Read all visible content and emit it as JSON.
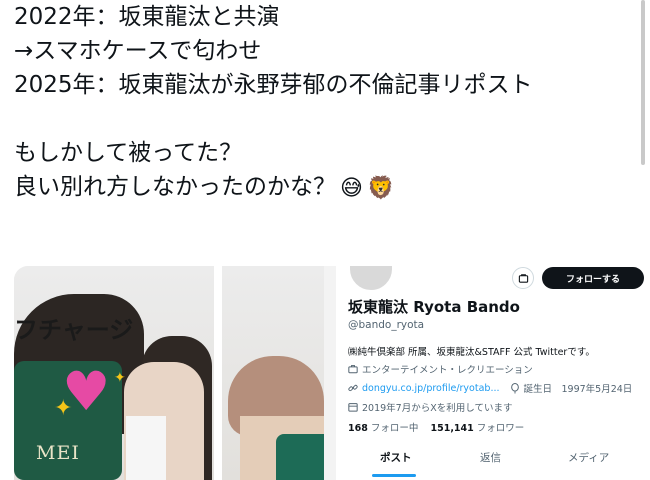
{
  "post": {
    "line1": "2022年：坂東龍汰と共演",
    "line2": "→スマホケースで匂わせ",
    "line3": "2025年：坂東龍汰が永野芽郁の不倫記事リポスト",
    "line4": "もしかして被ってた？",
    "line5": "良い別れ方しなかったのかな？",
    "emoji1": "😅",
    "emoji2": "🦁"
  },
  "photo": {
    "sign_text": "フチャージ",
    "phone_case_text": "MEI"
  },
  "profile": {
    "follow_label": "フォローする",
    "display_name": "坂東龍汰 Ryota Bando",
    "handle": "@bando_ryota",
    "bio": "㈱純牛倶楽部 所属、坂東龍汰&STAFF 公式 Twitterです。",
    "category": "エンターテイメント・レクリエーション",
    "website": "dongyu.co.jp/profile/ryotab...",
    "birthday": "誕生日　1997年5月24日",
    "joined": "2019年7月からXを利用しています",
    "following_count": "168",
    "following_label": "フォロー中",
    "followers_count": "151,141",
    "followers_label": "フォロワー",
    "tabs": [
      "ポスト",
      "返信",
      "メディア"
    ]
  },
  "colors": {
    "text": "#0f1419",
    "secondary": "#536471",
    "accent": "#1d9bf0",
    "follow_button_bg": "#0f1419"
  },
  "icons": [
    "message-icon",
    "briefcase-icon",
    "link-icon",
    "balloon-icon",
    "calendar-icon",
    "heart-emoji",
    "sparkle-emoji"
  ]
}
